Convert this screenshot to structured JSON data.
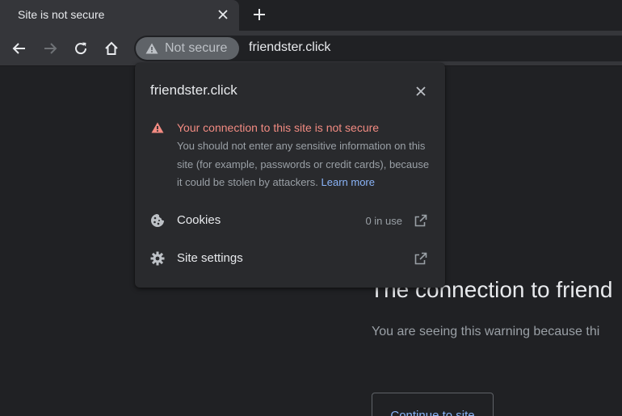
{
  "tab": {
    "title": "Site is not secure"
  },
  "toolbar": {
    "security_chip_label": "Not secure",
    "url": "friendster.click"
  },
  "popup": {
    "title": "friendster.click",
    "warning_title": "Your connection to this site is not secure",
    "warning_body": "You should not enter any sensitive information on this site (for example, passwords or credit cards), because it could be stolen by attackers.",
    "learn_more": "Learn more",
    "rows": [
      {
        "label": "Cookies",
        "count": "0 in use",
        "icon": "cookie-icon"
      },
      {
        "label": "Site settings",
        "count": "",
        "icon": "gear-icon"
      }
    ]
  },
  "page": {
    "heading": "The connection to friend",
    "description": "You are seeing this warning because thi",
    "continue_label": "Continue to site"
  },
  "colors": {
    "warning_red": "#f28b82",
    "link_blue": "#8ab4f8",
    "popup_bg": "#292a2d",
    "toolbar_bg": "#35363a",
    "page_bg": "#202124"
  }
}
